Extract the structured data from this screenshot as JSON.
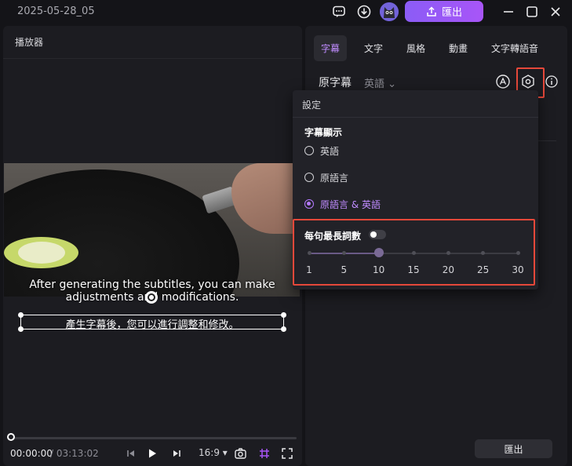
{
  "titlebar": {
    "project_name": "2025-05-28_05",
    "export_label": "匯出",
    "icons": [
      "feedback-icon",
      "download-icon",
      "avatar",
      "minimize-icon",
      "maximize-icon",
      "close-icon"
    ]
  },
  "player": {
    "title": "播放器",
    "subtitle_en": "After generating the subtitles, you can make adjustments and modifications.",
    "subtitle_zh": "產生字幕後，您可以進行調整和修改。",
    "time_current": "00:00:00",
    "time_total": "/ 03:13:02",
    "aspect_ratio": "16:9",
    "progress": 0
  },
  "right_panel": {
    "tabs": [
      "字幕",
      "文字",
      "風格",
      "動畫",
      "文字轉語音"
    ],
    "active_tab": "字幕",
    "source_label": "原字幕",
    "source_language": "英語",
    "export_label": "匯出"
  },
  "settings_popup": {
    "title": "設定",
    "display_section": "字幕顯示",
    "options": [
      "英語",
      "原語言",
      "原語言 & 英語"
    ],
    "selected_option": "原語言 & 英語",
    "max_length_label": "每句最長詞數",
    "max_length_enabled": false,
    "slider_labels": [
      "1",
      "5",
      "10",
      "15",
      "20",
      "25",
      "30"
    ],
    "slider_value": 10
  },
  "colors": {
    "accent": "#a855f7",
    "highlight_box": "#e5483a"
  }
}
